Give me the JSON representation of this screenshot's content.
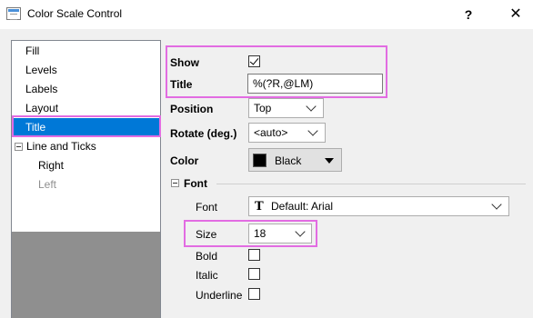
{
  "window": {
    "title": "Color Scale Control",
    "help_label": "?",
    "close_label": "✕"
  },
  "tree": {
    "items": [
      {
        "label": "Fill"
      },
      {
        "label": "Levels"
      },
      {
        "label": "Labels"
      },
      {
        "label": "Layout"
      },
      {
        "label": "Title",
        "selected": true
      },
      {
        "label": "Line and Ticks",
        "expanded": true
      },
      {
        "label": "Right"
      },
      {
        "label": "Left",
        "disabled": true
      }
    ]
  },
  "form": {
    "show": {
      "label": "Show",
      "checked": true
    },
    "title": {
      "label": "Title",
      "value": "%(?R,@LM)"
    },
    "position": {
      "label": "Position",
      "value": "Top"
    },
    "rotate": {
      "label": "Rotate (deg.)",
      "value": "<auto>"
    },
    "color": {
      "label": "Color",
      "value": "Black",
      "swatch": "#000000"
    },
    "font_group": {
      "label": "Font",
      "font": {
        "label": "Font",
        "value": "Default: Arial",
        "icon": "truetype-font-icon"
      },
      "size": {
        "label": "Size",
        "value": "18"
      },
      "bold": {
        "label": "Bold",
        "checked": false
      },
      "italic": {
        "label": "Italic",
        "checked": false
      },
      "underline": {
        "label": "Underline",
        "checked": false
      }
    }
  },
  "colors": {
    "selection": "#0078d7",
    "highlight": "#e26ce2",
    "tree_empty": "#8f8f8f"
  }
}
